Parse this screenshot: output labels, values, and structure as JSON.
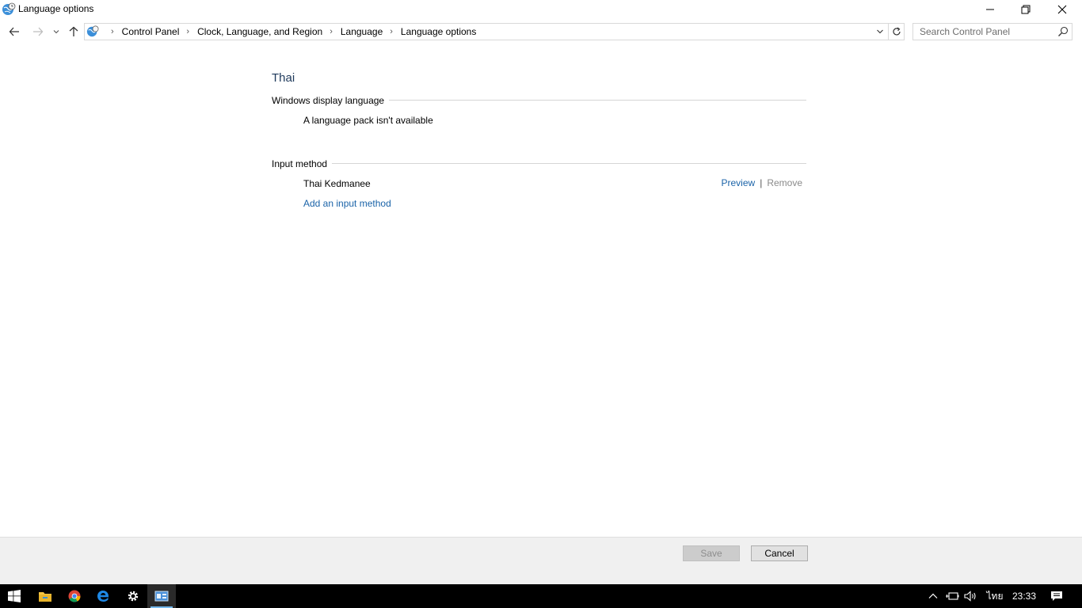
{
  "window": {
    "title": "Language options",
    "icon": "globe-clock-icon"
  },
  "addressbar": {
    "breadcrumbs": [
      "Control Panel",
      "Clock, Language, and Region",
      "Language",
      "Language options"
    ],
    "search_placeholder": "Search Control Panel"
  },
  "main": {
    "heading": "Thai",
    "display_section": {
      "label": "Windows display language",
      "status": "A language pack isn't available"
    },
    "input_section": {
      "label": "Input method",
      "method_name": "Thai Kedmanee",
      "preview_link": "Preview",
      "separator": "|",
      "remove_link": "Remove",
      "add_link": "Add an input method"
    }
  },
  "footer": {
    "save_label": "Save",
    "cancel_label": "Cancel"
  },
  "taskbar": {
    "apps": [
      "start-icon",
      "file-explorer-icon",
      "chrome-icon",
      "edge-icon",
      "settings-icon",
      "control-panel-icon"
    ],
    "language": "ไทย",
    "time": "23:33"
  },
  "colors": {
    "link": "#1a63a8",
    "heading": "#1e395b",
    "footer_bg": "#f0f0f0",
    "taskbar_bg": "#000000"
  }
}
